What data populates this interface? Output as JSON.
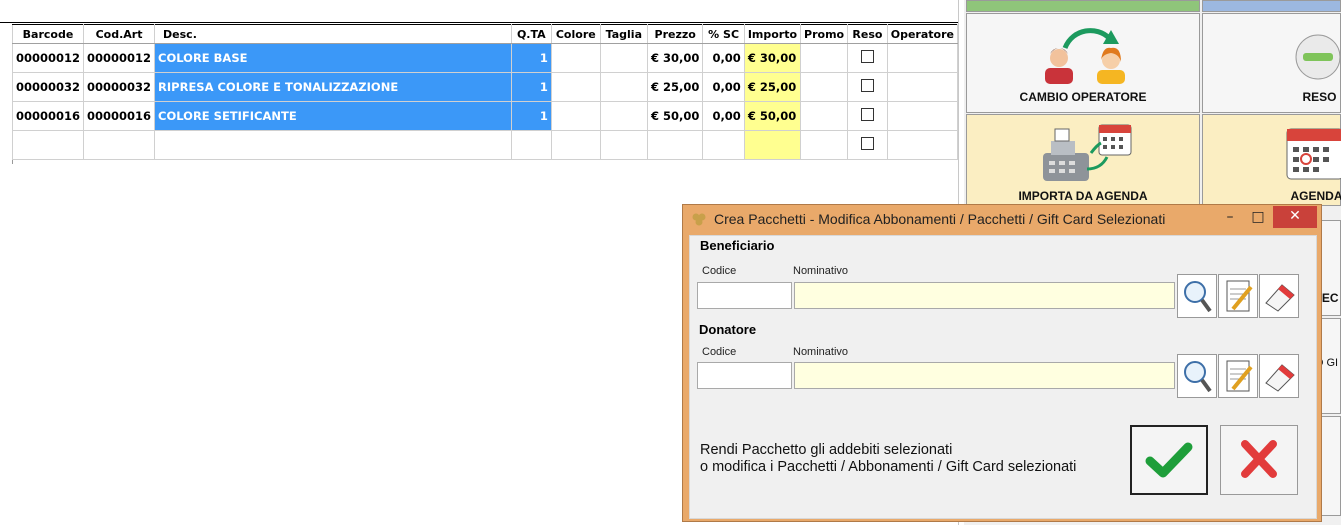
{
  "grid": {
    "columns": [
      "Barcode",
      "Cod.Art",
      "Desc.",
      "Q.TA",
      "Colore",
      "Taglia",
      "Prezzo",
      "% SC",
      "Importo",
      "Promo",
      "Reso",
      "Operatore"
    ],
    "rows": [
      {
        "barcode": "00000012",
        "codart": "00000012",
        "desc": "COLORE BASE",
        "qta": "1",
        "colore": "",
        "taglia": "",
        "prezzo": "€ 30,00",
        "sc": "0,00",
        "importo": "€ 30,00",
        "promo": "",
        "operatore": ""
      },
      {
        "barcode": "00000032",
        "codart": "00000032",
        "desc": "RIPRESA COLORE E TONALIZZAZIONE",
        "qta": "1",
        "colore": "",
        "taglia": "",
        "prezzo": "€ 25,00",
        "sc": "0,00",
        "importo": "€ 25,00",
        "promo": "",
        "operatore": ""
      },
      {
        "barcode": "00000016",
        "codart": "00000016",
        "desc": "COLORE SETIFICANTE",
        "qta": "1",
        "colore": "",
        "taglia": "",
        "prezzo": "€ 50,00",
        "sc": "0,00",
        "importo": "€ 50,00",
        "promo": "",
        "operatore": ""
      },
      {
        "barcode": "",
        "codart": "",
        "desc": "",
        "qta": "",
        "colore": "",
        "taglia": "",
        "prezzo": "",
        "sc": "",
        "importo": "",
        "promo": "",
        "operatore": ""
      }
    ]
  },
  "tiles": {
    "cambio_operatore": "CAMBIO OPERATORE",
    "reso": "RESO",
    "importa_da_agenda": "IMPORTA DA AGENDA",
    "agenda": "AGENDA",
    "partial_tile_1": "TEC",
    "partial_tile_2": "O GI"
  },
  "dialog": {
    "title": "Crea Pacchetti - Modifica Abbonamenti / Pacchetti / Gift Card Selezionati",
    "beneficiario": {
      "heading": "Beneficiario",
      "codice_label": "Codice",
      "nominativo_label": "Nominativo",
      "codice_value": "",
      "nominativo_value": ""
    },
    "donatore": {
      "heading": "Donatore",
      "codice_label": "Codice",
      "nominativo_label": "Nominativo",
      "codice_value": "",
      "nominativo_value": ""
    },
    "message_line1": "Rendi Pacchetto gli addebiti selezionati",
    "message_line2": "o modifica i Pacchetti / Abbonamenti / Gift Card selezionati"
  },
  "colors": {
    "selection": "#3b98f8",
    "importo": "#ffff90",
    "dialog_frame": "#e9a96a",
    "tile_peach": "#fbeec2",
    "confirm": "#1e9e3a",
    "cancel": "#e23b3b"
  }
}
